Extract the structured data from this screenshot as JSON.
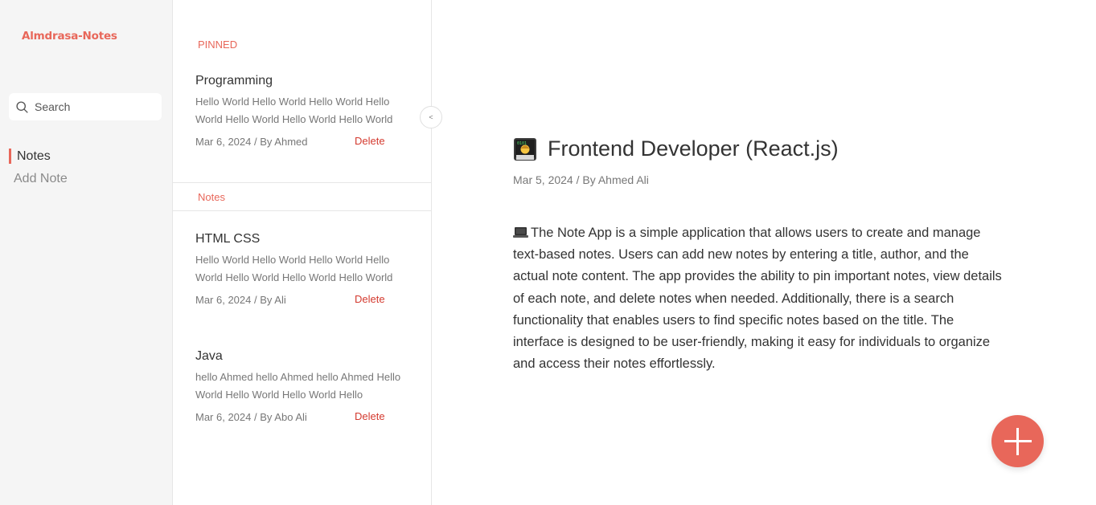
{
  "brand": "Almdrasa-Notes",
  "search": {
    "placeholder": "Search",
    "value": ""
  },
  "nav": {
    "notes": "Notes",
    "add_note": "Add Note"
  },
  "list": {
    "pinned_label": "PINNED",
    "notes_label": "Notes",
    "collapse_glyph": "<",
    "pinned": [
      {
        "title": "Programming",
        "body": "Hello World Hello World Hello World Hello World Hello World Hello World Hello World",
        "date": "Mar 6, 2024",
        "author": "/ By Ahmed",
        "delete": "Delete"
      }
    ],
    "notes": [
      {
        "title": "HTML CSS",
        "body": "Hello World Hello World Hello World Hello World Hello World Hello World Hello World",
        "date": "Mar 6, 2024",
        "author": "/ By Ali",
        "delete": "Delete"
      },
      {
        "title": "Java",
        "body": "hello Ahmed hello Ahmed hello Ahmed Hello World Hello World Hello World Hello",
        "date": "Mar 6, 2024",
        "author": "/ By Abo Ali",
        "delete": "Delete"
      }
    ]
  },
  "detail": {
    "title_icon": "technologist-emoji-icon",
    "title": "Frontend Developer (React.js)",
    "date": "Mar 5, 2024",
    "author": "/ By Ahmed Ali",
    "body_icon": "laptop-icon",
    "body": "The Note App is a simple application that allows users to create and manage text-based notes. Users can add new notes by entering a title, author, and the actual note content. The app provides the ability to pin important notes, view details of each note, and delete notes when needed. Additionally, there is a search functionality that enables users to find specific notes based on the title. The interface is designed to be user-friendly, making it easy for individuals to organize and access their notes effortlessly."
  },
  "fab": {
    "icon": "plus-icon"
  },
  "colors": {
    "accent": "#e8675a",
    "danger": "#d43a2f",
    "sidebar_bg": "#f5f5f5"
  }
}
